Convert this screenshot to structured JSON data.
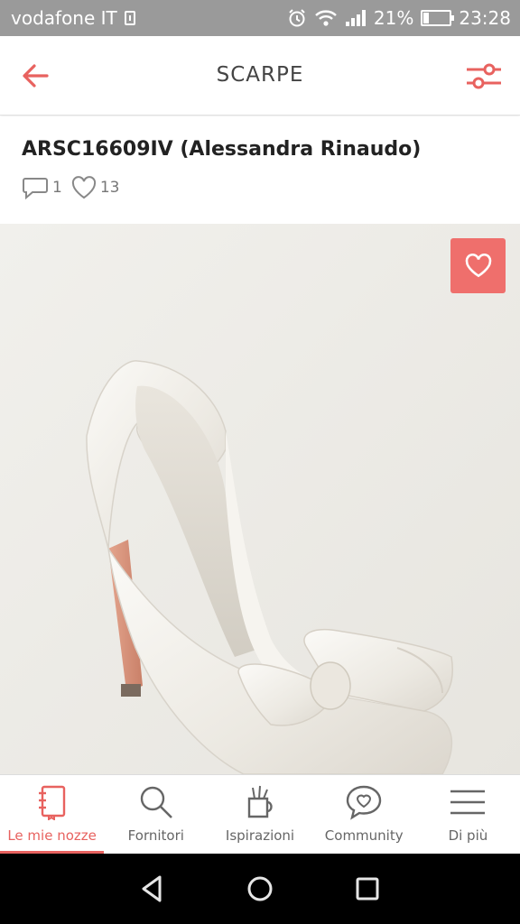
{
  "status_bar": {
    "carrier": "vodafone IT",
    "battery": "21%",
    "battery_level": 0.21,
    "time": "23:28"
  },
  "app_bar": {
    "title": "SCARPE"
  },
  "product": {
    "title": "ARSC16609IV (Alessandra Rinaudo)",
    "comments_count": "1",
    "likes_count": "13"
  },
  "bottom_nav": {
    "items": [
      {
        "label": "Le mie nozze",
        "icon": "notebook-icon",
        "active": true
      },
      {
        "label": "Fornitori",
        "icon": "search-icon",
        "active": false
      },
      {
        "label": "Ispirazioni",
        "icon": "inspiration-icon",
        "active": false
      },
      {
        "label": "Community",
        "icon": "community-icon",
        "active": false
      },
      {
        "label": "Di più",
        "icon": "menu-icon",
        "active": false
      }
    ]
  },
  "colors": {
    "accent": "#e8625f",
    "favorite_button": "#ef6f6c",
    "status_bar": "#9a9a9a"
  }
}
